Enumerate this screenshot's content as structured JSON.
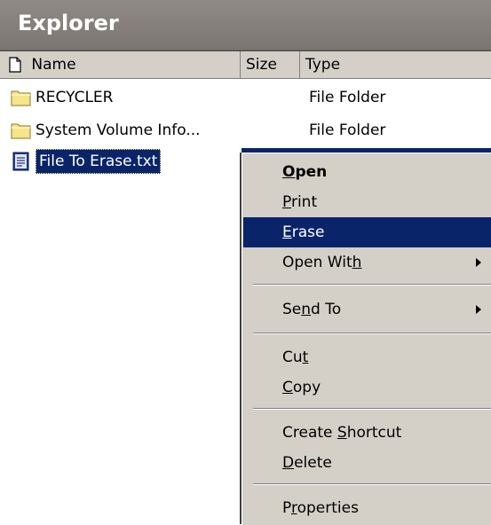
{
  "window": {
    "title": "Explorer"
  },
  "columns": {
    "name": "Name",
    "size": "Size",
    "type": "Type"
  },
  "files": [
    {
      "name": "RECYCLER",
      "type": "File Folder",
      "icon": "folder-icon"
    },
    {
      "name": "System Volume Info...",
      "type": "File Folder",
      "icon": "folder-icon"
    },
    {
      "name": "File To Erase.txt",
      "type": "",
      "icon": "text-file-icon",
      "selected": true
    }
  ],
  "context_menu": {
    "open": {
      "pre": "",
      "key": "O",
      "post": "pen"
    },
    "print": {
      "pre": "",
      "key": "P",
      "post": "rint"
    },
    "erase": {
      "pre": "",
      "key": "E",
      "post": "rase"
    },
    "open_with": {
      "pre": "Open Wit",
      "key": "h",
      "post": ""
    },
    "send_to": {
      "pre": "Se",
      "key": "n",
      "post": "d To"
    },
    "cut": {
      "pre": "Cu",
      "key": "t",
      "post": ""
    },
    "copy": {
      "pre": "",
      "key": "C",
      "post": "opy"
    },
    "create_shortcut": {
      "pre": "Create ",
      "key": "S",
      "post": "hortcut"
    },
    "delete": {
      "pre": "",
      "key": "D",
      "post": "elete"
    },
    "properties": {
      "pre": "P",
      "key": "r",
      "post": "operties"
    }
  },
  "colors": {
    "selection": "#0a246a",
    "menu_bg": "#d4d0c8",
    "title_bg": "#847f7a"
  }
}
